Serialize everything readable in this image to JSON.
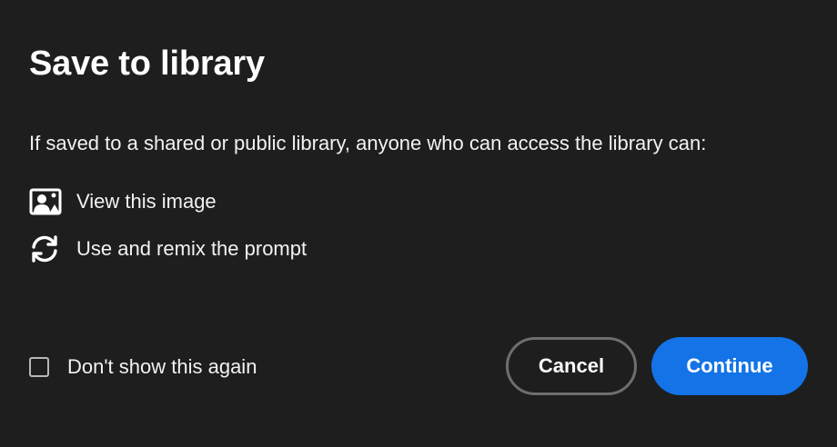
{
  "dialog": {
    "title": "Save to library",
    "description": "If saved to a shared or public library, anyone who can access the library can:",
    "permissions": [
      {
        "icon": "image-person-icon",
        "label": "View this image"
      },
      {
        "icon": "refresh-icon",
        "label": "Use and remix the prompt"
      }
    ],
    "checkbox": {
      "label": "Don't show this again",
      "checked": false
    },
    "buttons": {
      "cancel_label": "Cancel",
      "continue_label": "Continue"
    },
    "colors": {
      "background": "#1e1e1e",
      "accent": "#1473e6",
      "text": "#ffffff",
      "cancel_border": "#6e6e6e"
    }
  }
}
